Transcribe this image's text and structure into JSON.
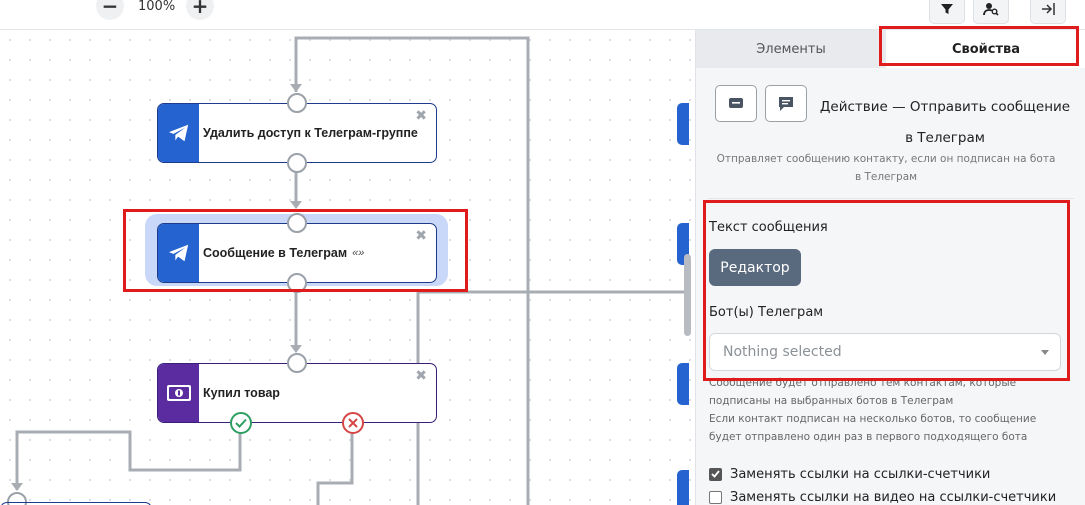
{
  "toolbar": {
    "zoom_out_glyph": "−",
    "zoom_level": "100%",
    "zoom_in_glyph": "+",
    "filter_icon": "filter-icon",
    "user_search_icon": "user-search-icon",
    "collapse_icon": "collapse-right-icon"
  },
  "nodes": [
    {
      "title": "Удалить доступ к Телеграм-группе",
      "subtitle": "",
      "icon": "telegram-icon",
      "color": "#2563d0"
    },
    {
      "title": "Сообщение в Телеграм",
      "subtitle": "«»",
      "icon": "telegram-icon",
      "color": "#2563d0",
      "selected": true
    },
    {
      "title": "Купил товар",
      "subtitle": "",
      "icon": "money-icon",
      "color": "#5a2ca0"
    }
  ],
  "node_close_glyph": "✖",
  "panel": {
    "tabs": [
      {
        "label": "Элементы",
        "active": false
      },
      {
        "label": "Свойства",
        "active": true
      }
    ],
    "action_title": "Действие — Отправить сообщение в Телеграм",
    "action_description": "Отправляет сообщению контакту, если он подписан на бота в Телеграм",
    "message_text_label": "Текст сообщения",
    "editor_button": "Редактор",
    "bots_label": "Бот(ы) Телеграм",
    "bots_placeholder": "Nothing selected",
    "note_1": "Сообщение будет отправлено тем контактам, которые подписаны на выбранных ботов в Телеграм",
    "note_2": "Если контакт подписан на несколько ботов, то сообщение будет отправлено один раз в первого подходящего бота",
    "checkboxes": [
      {
        "label": "Заменять ссылки на ссылки-счетчики",
        "checked": true
      },
      {
        "label": "Заменять ссылки на видео на ссылки-счетчики",
        "checked": false
      }
    ]
  },
  "colors": {
    "highlight": "#e01b1b",
    "node_blue": "#2563d0",
    "node_purple": "#5a2ca0",
    "success": "#2e9e63",
    "fail": "#d54545"
  }
}
